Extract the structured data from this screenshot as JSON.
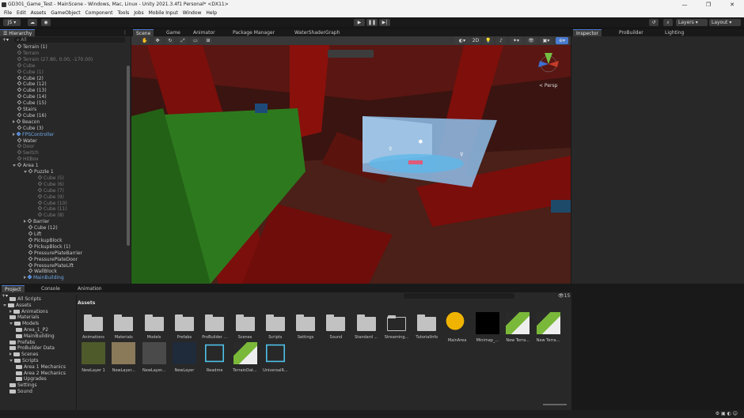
{
  "window": {
    "title": "GD301_Game_Test - MainScene - Windows, Mac, Linux - Unity 2021.3.4f1 Personal* <DX11>",
    "min": "—",
    "max": "❐",
    "close": "✕"
  },
  "menu": [
    "File",
    "Edit",
    "Assets",
    "GameObject",
    "Component",
    "Tools",
    "Jobs",
    "Mobile Input",
    "Window",
    "Help"
  ],
  "toolbar": {
    "account": "JS ▾",
    "layers": "Layers",
    "layout": "Layout"
  },
  "hierarchy": {
    "tab": "Hierarchy",
    "search": "All",
    "rows": [
      {
        "t": "Terrain (1)",
        "d": 1,
        "s": "n"
      },
      {
        "t": "Terrain",
        "d": 1,
        "s": "dim"
      },
      {
        "t": "Terrain (27.80, 0.00, -170.00)",
        "d": 1,
        "s": "dim"
      },
      {
        "t": "Cube",
        "d": 1,
        "s": "dim"
      },
      {
        "t": "Cube (1)",
        "d": 1,
        "s": "dim"
      },
      {
        "t": "Cube (2)",
        "d": 1,
        "s": "n"
      },
      {
        "t": "Cube (12)",
        "d": 1,
        "s": "n"
      },
      {
        "t": "Cube (13)",
        "d": 1,
        "s": "n"
      },
      {
        "t": "Cube (14)",
        "d": 1,
        "s": "n"
      },
      {
        "t": "Cube (15)",
        "d": 1,
        "s": "n"
      },
      {
        "t": "Stairs",
        "d": 1,
        "s": "n"
      },
      {
        "t": "Cube (16)",
        "d": 1,
        "s": "n"
      },
      {
        "t": "Beacon",
        "d": 1,
        "s": "n",
        "a": "r"
      },
      {
        "t": "Cube (3)",
        "d": 1,
        "s": "n"
      },
      {
        "t": "FPSController",
        "d": 1,
        "s": "blue",
        "a": "r"
      },
      {
        "t": "Water",
        "d": 1,
        "s": "n"
      },
      {
        "t": "Door",
        "d": 1,
        "s": "dim"
      },
      {
        "t": "Switch",
        "d": 1,
        "s": "dim"
      },
      {
        "t": "HitBox",
        "d": 1,
        "s": "dim"
      },
      {
        "t": "Area 1",
        "d": 1,
        "s": "n",
        "a": "d"
      },
      {
        "t": "Puzzle 1",
        "d": 2,
        "s": "n",
        "a": "d"
      },
      {
        "t": "Cube (5)",
        "d": 3,
        "s": "dim"
      },
      {
        "t": "Cube (6)",
        "d": 3,
        "s": "dim"
      },
      {
        "t": "Cube (7)",
        "d": 3,
        "s": "dim"
      },
      {
        "t": "Cube (9)",
        "d": 3,
        "s": "dim"
      },
      {
        "t": "Cube (10)",
        "d": 3,
        "s": "dim"
      },
      {
        "t": "Cube (11)",
        "d": 3,
        "s": "dim"
      },
      {
        "t": "Cube (8)",
        "d": 3,
        "s": "dim"
      },
      {
        "t": "Barrier",
        "d": 2,
        "s": "n",
        "a": "r"
      },
      {
        "t": "Cube (12)",
        "d": 2,
        "s": "n"
      },
      {
        "t": "Lift",
        "d": 2,
        "s": "n"
      },
      {
        "t": "PickupBlock",
        "d": 2,
        "s": "n"
      },
      {
        "t": "PickupBlock (1)",
        "d": 2,
        "s": "n"
      },
      {
        "t": "PressurePlateBarrier",
        "d": 2,
        "s": "n"
      },
      {
        "t": "PressurePlateDoor",
        "d": 2,
        "s": "n"
      },
      {
        "t": "PressurePlateLift",
        "d": 2,
        "s": "n"
      },
      {
        "t": "WallBlock",
        "d": 2,
        "s": "n"
      },
      {
        "t": "MainBuilding",
        "d": 2,
        "s": "blue",
        "a": "r"
      }
    ]
  },
  "scene": {
    "tabs": [
      "Scene",
      "Game",
      "Animator",
      "Package Manager",
      "WaterShaderGraph"
    ],
    "persp": "< Persp",
    "mode2d": "2D"
  },
  "inspector": {
    "tabs": [
      "Inspector",
      "ProBuilder",
      "Lighting"
    ]
  },
  "project": {
    "tabs": [
      "Project",
      "Console",
      "Animation"
    ],
    "count": "15",
    "breadcrumb": "Assets",
    "tree": [
      {
        "t": "All Scripts",
        "d": 1
      },
      {
        "t": "Assets",
        "d": 0,
        "a": "d"
      },
      {
        "t": "Animations",
        "d": 1,
        "a": "r"
      },
      {
        "t": "Materials",
        "d": 1
      },
      {
        "t": "Models",
        "d": 1,
        "a": "d"
      },
      {
        "t": "Area_1_P2",
        "d": 2
      },
      {
        "t": "MainBuilding",
        "d": 2
      },
      {
        "t": "Prefabs",
        "d": 1
      },
      {
        "t": "ProBuilder Data",
        "d": 1
      },
      {
        "t": "Scenes",
        "d": 1,
        "a": "r"
      },
      {
        "t": "Scripts",
        "d": 1,
        "a": "d"
      },
      {
        "t": "Area 1 Mechanics",
        "d": 2
      },
      {
        "t": "Area 2 Mechanics",
        "d": 2
      },
      {
        "t": "Upgrades",
        "d": 2
      },
      {
        "t": "Settings",
        "d": 1
      },
      {
        "t": "Sound",
        "d": 1
      }
    ],
    "assets": [
      {
        "n": "Animations",
        "k": "folder"
      },
      {
        "n": "Materials",
        "k": "folder"
      },
      {
        "n": "Models",
        "k": "folder"
      },
      {
        "n": "Prefabs",
        "k": "folder"
      },
      {
        "n": "ProBuilder ...",
        "k": "folder"
      },
      {
        "n": "Scenes",
        "k": "folder"
      },
      {
        "n": "Scripts",
        "k": "folder"
      },
      {
        "n": "Settings",
        "k": "folder"
      },
      {
        "n": "Sound",
        "k": "folder"
      },
      {
        "n": "Standard ...",
        "k": "folder"
      },
      {
        "n": "Streaming...",
        "k": "folderempty"
      },
      {
        "n": "TutorialInfo",
        "k": "folder"
      },
      {
        "n": "MainArea",
        "k": "scenefile"
      },
      {
        "n": "Minimap_...",
        "k": "black"
      },
      {
        "n": "New Terra...",
        "k": "terrain"
      },
      {
        "n": "New Terra...",
        "k": "terrain"
      },
      {
        "n": "NewLayer 1",
        "k": "grass"
      },
      {
        "n": "NewLayer...",
        "k": "rock"
      },
      {
        "n": "NewLayer...",
        "k": "grey"
      },
      {
        "n": "NewLayer",
        "k": "navy"
      },
      {
        "n": "Readme",
        "k": "cube"
      },
      {
        "n": "TerrainDat...",
        "k": "terrain"
      },
      {
        "n": "UniversalR...",
        "k": "cube"
      }
    ]
  }
}
